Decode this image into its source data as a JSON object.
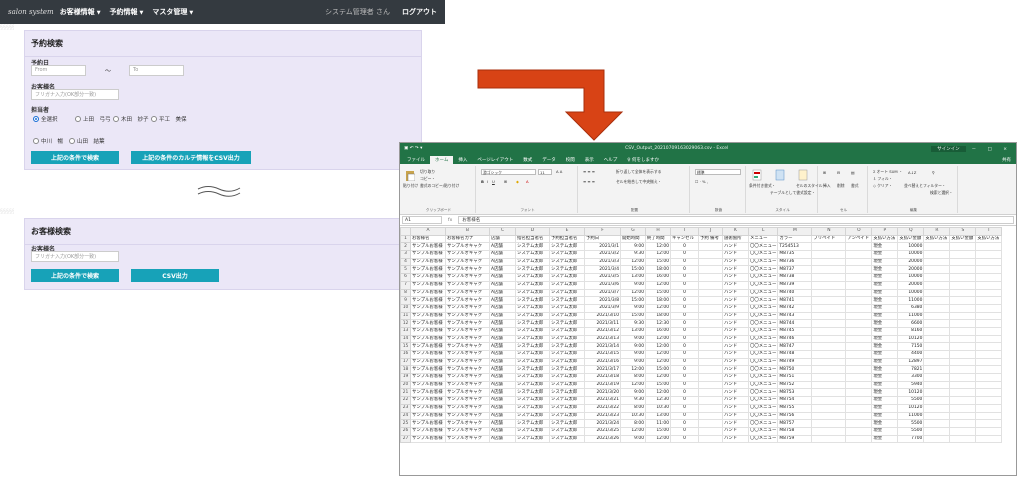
{
  "navbar": {
    "brand": "salon system",
    "menus": [
      "お客様情報",
      "予約情報",
      "マスタ管理"
    ],
    "user": "システム管理者 さん",
    "logout": "ログアウト"
  },
  "reservation_search": {
    "title": "予約検索",
    "date_label": "予約日",
    "date_from_placeholder": "From",
    "date_sep": "〜",
    "date_to_placeholder": "To",
    "customer_label": "お客様名",
    "customer_placeholder": "フリガナ入力(OK部分一致)",
    "staff_label": "担当者",
    "staff_options": [
      {
        "label": "全選択",
        "selected": true
      },
      {
        "label": "上田　弓弓",
        "selected": false
      },
      {
        "label": "木田　妙子",
        "selected": false
      },
      {
        "label": "平工　美保",
        "selected": false
      },
      {
        "label": "中川　暢",
        "selected": false
      },
      {
        "label": "山田　結葉",
        "selected": false
      }
    ],
    "search_button": "上記の条件で検索",
    "csv_button": "上記の条件のカルテ情報をCSV出力"
  },
  "customer_search": {
    "title": "お客様検索",
    "customer_label": "お客様名",
    "customer_placeholder": "フリガナ入力(OK部分一致)",
    "search_button": "上記の条件で検索",
    "csv_button": "CSV出力"
  },
  "excel": {
    "title": "CSV_Output_20210709163029063.csv - Excel",
    "sign_in": "サインイン",
    "window_controls": "－ □ ×",
    "tabs": [
      "ファイル",
      "ホーム",
      "挿入",
      "ページレイアウト",
      "数式",
      "データ",
      "校閲",
      "表示",
      "ヘルプ",
      "♀ 何をしますか"
    ],
    "active_tab": 1,
    "share": "共有",
    "ribbon": {
      "groups": [
        "クリップボード",
        "フォント",
        "配置",
        "数値",
        "スタイル",
        "セル",
        "編集"
      ],
      "paste": "貼り付け",
      "cut": "切り取り",
      "copy": "コピー・",
      "format_painter": "書式のコピー/貼り付け",
      "font_name": "游ゴシック",
      "font_size": "11",
      "wrap": "折り返して全体を表示する",
      "merge": "セルを結合して中央揃え・",
      "number_format": "標準",
      "cond_format": "条件付き書式・",
      "table_format": "テーブルとして書式設定・",
      "cell_style": "セルのスタイル・",
      "insert": "挿入",
      "delete": "削除",
      "format": "書式",
      "autosum": "オート SUM ・",
      "fill": "フィル・",
      "clear": "クリア・",
      "sort": "並べ替えとフィルター・",
      "find": "検索と選択・"
    },
    "name_box": "A1",
    "fx": "fx",
    "formula_value": "お客様名",
    "columns": [
      "A",
      "B",
      "C",
      "D",
      "E",
      "F",
      "G",
      "H",
      "I",
      "J",
      "K",
      "L",
      "M",
      "N",
      "O",
      "P",
      "Q",
      "R",
      "S",
      "T"
    ],
    "header_row": [
      "お客様名",
      "お客様名カナ",
      "店舗",
      "指名担当者名",
      "予約担当者名",
      "予約日",
      "開始時間",
      "終了時間",
      "キャンセル",
      "予約 備考",
      "施術箇所",
      "メニュー",
      "カラー",
      "ブリペイド",
      "アンペイド",
      "支払い方法",
      "支払い金額",
      "支払い方法",
      "支払い金額",
      "支払い方法"
    ],
    "rows": [
      [
        "2021/3/1",
        "9:00",
        "12:00",
        "ハンド",
        "〇〇メニュー",
        "T254513",
        "現金",
        "10000"
      ],
      [
        "2021/3/2",
        "9:30",
        "12:00",
        "ハンド",
        "〇〇メニュー",
        "M8735",
        "現金",
        "10000"
      ],
      [
        "2021/3/3",
        "12:00",
        "15:00",
        "ハンド",
        "〇〇メニュー",
        "M8736",
        "現金",
        "20000"
      ],
      [
        "2021/3/4",
        "15:00",
        "18:00",
        "ハンド",
        "〇〇メニュー",
        "M8737",
        "現金",
        "20000"
      ],
      [
        "2021/3/5",
        "13:00",
        "16:00",
        "ハンド",
        "〇〇メニュー",
        "M8738",
        "現金",
        "10000"
      ],
      [
        "2021/3/6",
        "9:00",
        "12:00",
        "ハンド",
        "〇〇メニュー",
        "M8739",
        "現金",
        "20000"
      ],
      [
        "2021/3/7",
        "12:00",
        "15:00",
        "ハンド",
        "〇〇メニュー",
        "M8740",
        "現金",
        "10000"
      ],
      [
        "2021/3/8",
        "15:00",
        "18:00",
        "ハンド",
        "〇〇メニュー",
        "M8741",
        "現金",
        "11000"
      ],
      [
        "2021/3/9",
        "9:00",
        "12:00",
        "ハンド",
        "〇〇メニュー",
        "M8742",
        "現金",
        "6380"
      ],
      [
        "2021/3/10",
        "15:00",
        "18:00",
        "ハンド",
        "〇〇メニュー",
        "M8743",
        "現金",
        "11000"
      ],
      [
        "2021/3/11",
        "9:30",
        "12:30",
        "ハンド",
        "〇〇メニュー",
        "M8744",
        "現金",
        "6600"
      ],
      [
        "2021/3/12",
        "13:00",
        "16:00",
        "ハンド",
        "〇〇メニュー",
        "M8745",
        "現金",
        "8160"
      ],
      [
        "2021/3/13",
        "9:00",
        "12:00",
        "ハンド",
        "〇〇メニュー",
        "M8746",
        "現金",
        "10120"
      ],
      [
        "2021/3/14",
        "9:00",
        "12:00",
        "ハンド",
        "〇〇メニュー",
        "M8747",
        "現金",
        "7150"
      ],
      [
        "2021/3/15",
        "9:00",
        "12:00",
        "ハンド",
        "〇〇メニュー",
        "M8748",
        "現金",
        "4400"
      ],
      [
        "2021/3/16",
        "9:00",
        "12:00",
        "ハンド",
        "〇〇メニュー",
        "M8749",
        "現金",
        "12897"
      ],
      [
        "2021/3/17",
        "12:00",
        "15:00",
        "ハンド",
        "〇〇メニュー",
        "M8750",
        "現金",
        "7821"
      ],
      [
        "2021/3/18",
        "8:00",
        "12:00",
        "ハンド",
        "〇〇メニュー",
        "M8751",
        "現金",
        "3300"
      ],
      [
        "2021/3/19",
        "12:00",
        "15:00",
        "ハンド",
        "〇〇メニュー",
        "M8752",
        "現金",
        "5940"
      ],
      [
        "2021/3/20",
        "9:00",
        "12:00",
        "ハンド",
        "〇〇メニュー",
        "M8753",
        "現金",
        "10120"
      ],
      [
        "2021/3/21",
        "9:30",
        "12:30",
        "ハンド",
        "〇〇メニュー",
        "M8754",
        "現金",
        "5500"
      ],
      [
        "2021/3/22",
        "8:00",
        "10:30",
        "ハンド",
        "〇〇メニュー",
        "M8755",
        "現金",
        "10120"
      ],
      [
        "2021/3/23",
        "10:30",
        "13:00",
        "ハンド",
        "〇〇メニュー",
        "M8756",
        "現金",
        "11000"
      ],
      [
        "2021/3/24",
        "8:00",
        "11:00",
        "ハンド",
        "〇〇メニュー",
        "M8757",
        "現金",
        "5500"
      ],
      [
        "2021/3/25",
        "12:00",
        "15:00",
        "ハンド",
        "〇〇メニュー",
        "M8758",
        "現金",
        "5500"
      ],
      [
        "2021/3/26",
        "9:00",
        "12:00",
        "ハンド",
        "〇〇メニュー",
        "M8759",
        "現金",
        "7700"
      ]
    ],
    "common": {
      "customer": "サンプルお客様",
      "kana": "サンプルオキャク",
      "store": "A店舗",
      "staff": "システム太郎",
      "staff2": "システム太郎",
      "cancel": "0"
    }
  },
  "colors": {
    "navbar": "#343a40",
    "panel": "#ebe7f7",
    "button": "#17a2b8",
    "excel_green": "#217346",
    "arrow": "#d84315"
  }
}
